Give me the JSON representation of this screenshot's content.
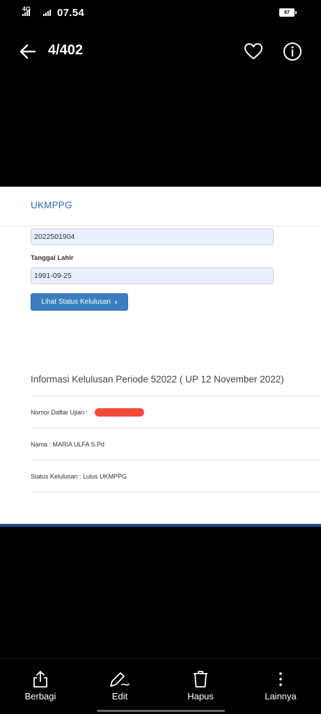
{
  "status_bar": {
    "network": "4G",
    "time": "07.54",
    "battery": "87"
  },
  "viewer": {
    "counter": "4/402",
    "back_icon": "arrow-left-icon",
    "favorite_icon": "heart-icon",
    "info_icon": "info-icon"
  },
  "webpage": {
    "brand": "UKMPPG",
    "registration_value": "2022501904",
    "dob_label": "Tanggal Lahir",
    "dob_value": "1991-09-25",
    "check_button": "Lihat Status Kelulusan",
    "info_title": "Informasi Kelulusan Periode 52022 ( UP 12 November 2022)",
    "exam_number_label": "Nomor Daftar Ujian :",
    "name_line": "Nama : MARIA ULFA S.Pd",
    "status_line": "Status Kelulusan : Lulus UKMPPG",
    "accent_color": "#3a7dc0",
    "redaction_color": "#f24a3a"
  },
  "toolbar": {
    "items": [
      {
        "label": "Berbagi",
        "icon": "share-icon"
      },
      {
        "label": "Edit",
        "icon": "edit-icon"
      },
      {
        "label": "Hapus",
        "icon": "trash-icon"
      },
      {
        "label": "Lainnya",
        "icon": "more-vertical-icon"
      }
    ]
  }
}
